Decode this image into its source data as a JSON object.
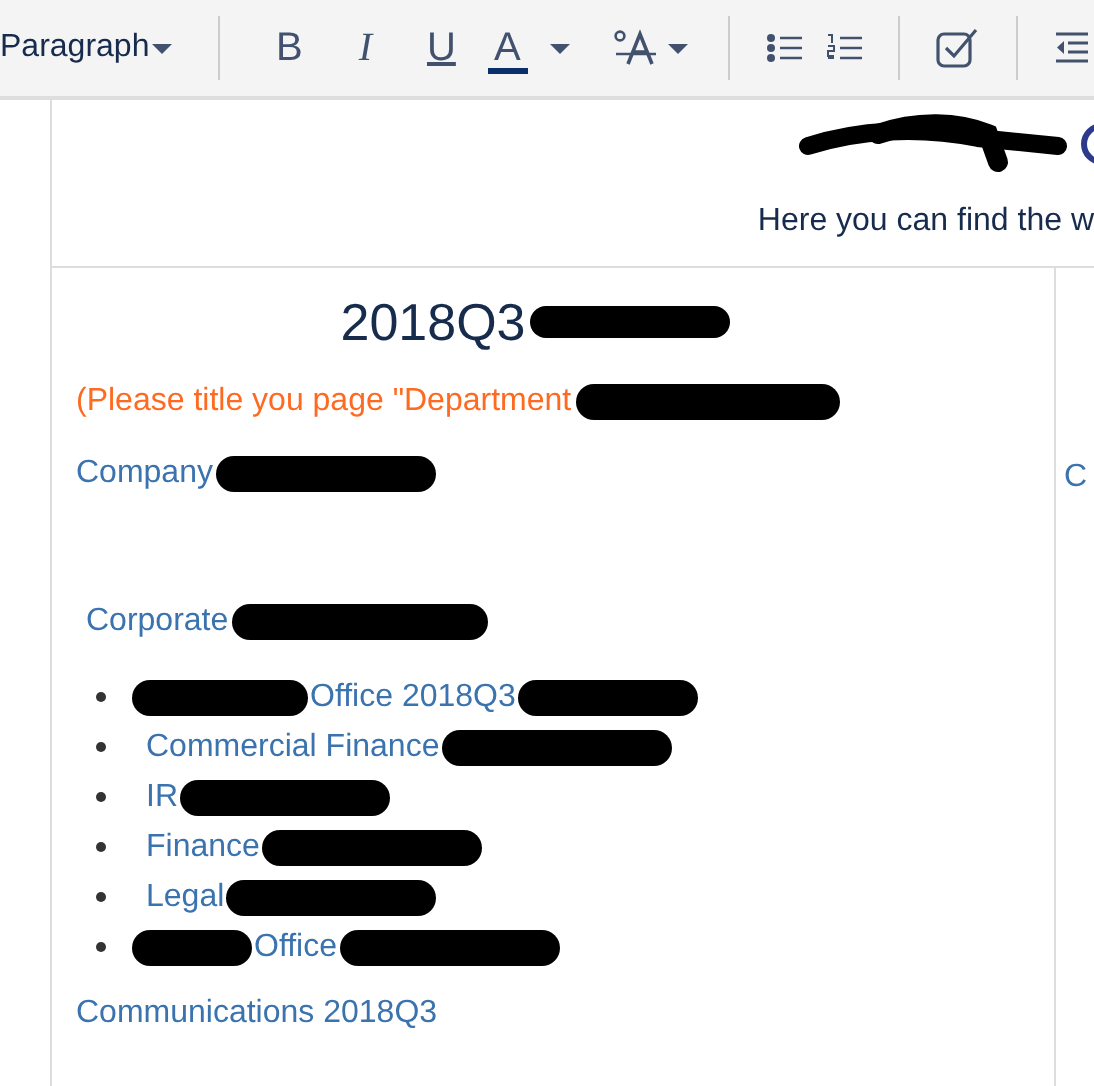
{
  "toolbar": {
    "style_dropdown": {
      "value": "Paragraph"
    },
    "format_buttons": [
      {
        "label": "B",
        "kind": "bold"
      },
      {
        "label": "I",
        "kind": "italic"
      },
      {
        "label": "U",
        "kind": "underline"
      },
      {
        "label": "A",
        "kind": "color"
      }
    ]
  },
  "header": {
    "intro": "Here you can find the w",
    "logo_redacted": true
  },
  "title": {
    "text": "2018Q3",
    "redacted": true
  },
  "note": {
    "text": "(Please title you page \"Department",
    "redacted": true
  },
  "company": {
    "text": "Company",
    "redacted": true
  },
  "right_column": {
    "text": "C"
  },
  "corporate": {
    "text": "Corporate",
    "redacted": true
  },
  "items": [
    {
      "text": "Office 2018Q3",
      "redacted_before": true,
      "redacted_after": true
    },
    {
      "text": "Commercial Finance",
      "redacted_before": false,
      "redacted_after": true
    },
    {
      "text": "IR",
      "redacted_before": false,
      "redacted_after": true
    },
    {
      "text": "Finance",
      "redacted_before": false,
      "redacted_after": true
    },
    {
      "text": "Legal",
      "redacted_before": false,
      "redacted_after": true
    },
    {
      "text": "Office",
      "redacted_before": true,
      "redacted_after": true
    }
  ],
  "communications": {
    "text": "Communications 2018Q3"
  }
}
